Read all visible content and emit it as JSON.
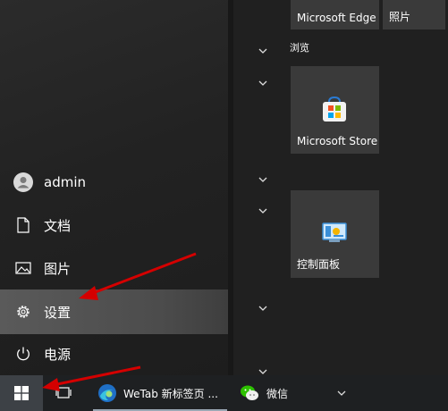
{
  "tiles": {
    "edge": "Microsoft Edge",
    "photos": "照片",
    "group_browse": "浏览",
    "store": "Microsoft Store",
    "control_panel": "控制面板"
  },
  "menu": {
    "user": "admin",
    "documents": "文档",
    "pictures": "图片",
    "settings": "设置",
    "power": "电源"
  },
  "taskbar": {
    "wetab": "WeTab 新标签页 ...",
    "wechat": "微信"
  },
  "colors": {
    "accent_blue": "#0078d4",
    "annotation_red": "#d40000",
    "wechat_green": "#2dc100"
  }
}
